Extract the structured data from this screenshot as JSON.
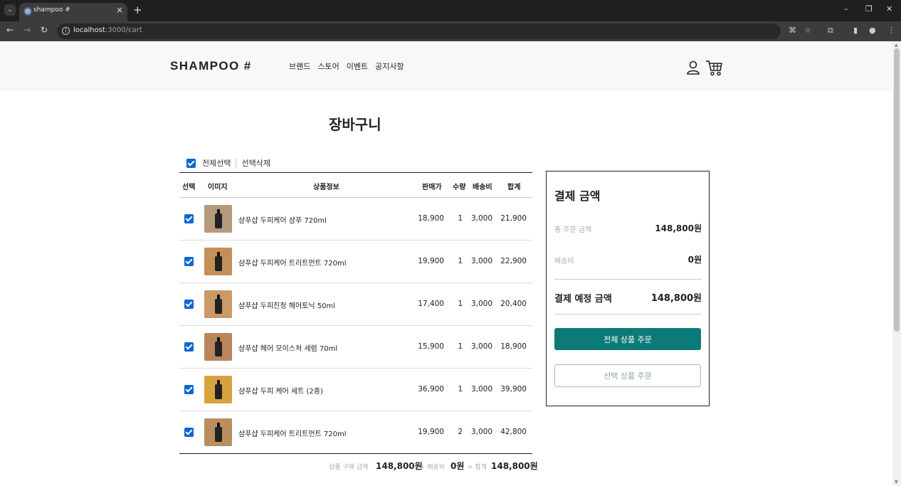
{
  "browser": {
    "tab_title": "shampoo #",
    "url_host": "localhost",
    "url_rest": ":3000/cart"
  },
  "header": {
    "logo": "SHAMPOO #",
    "nav": [
      "브랜드",
      "스토어",
      "이벤트",
      "공지사항"
    ]
  },
  "page_title": "장바구니",
  "select_bar": {
    "select_all": "전체선택",
    "delete_selected": "선택삭제"
  },
  "table": {
    "headers": {
      "select": "선택",
      "image": "이미지",
      "info": "상품정보",
      "price": "판매가",
      "qty": "수량",
      "shipping": "배송비",
      "total": "합계"
    },
    "rows": [
      {
        "name": "샴푸샵 두피케어 샴푸 720ml",
        "price": "18,900",
        "qty": "1",
        "shipping": "3,000",
        "total": "21,900",
        "checked": true,
        "thumb_bg": "#b49a7a"
      },
      {
        "name": "샴푸샵 두피케어 트리트먼트 720ml",
        "price": "19,900",
        "qty": "1",
        "shipping": "3,000",
        "total": "22,900",
        "checked": true,
        "thumb_bg": "#c49058"
      },
      {
        "name": "샴푸샵 두피진정 헤어토닉 50ml",
        "price": "17,400",
        "qty": "1",
        "shipping": "3,000",
        "total": "20,400",
        "checked": true,
        "thumb_bg": "#c99a66"
      },
      {
        "name": "샴푸샵 헤어 모이스처 세럼 70ml",
        "price": "15,900",
        "qty": "1",
        "shipping": "3,000",
        "total": "18,900",
        "checked": true,
        "thumb_bg": "#b8865a"
      },
      {
        "name": "샴푸샵 두피 케어 세트 (2종)",
        "price": "36,900",
        "qty": "1",
        "shipping": "3,000",
        "total": "39,900",
        "checked": true,
        "thumb_bg": "#d9a23c"
      },
      {
        "name": "샴푸샵 두피케어 트리트먼트 720ml",
        "price": "19,900",
        "qty": "2",
        "shipping": "3,000",
        "total": "42,800",
        "checked": true,
        "thumb_bg": "#b98f60"
      }
    ]
  },
  "summary_line": {
    "purchase_label": "상품 구매 금액",
    "purchase_value": "148,800원",
    "shipping_label": "+ 배송비",
    "shipping_value": "0원",
    "total_label": "= 합계",
    "total_value": "148,800원"
  },
  "payment": {
    "title": "결제 금액",
    "order_total_label": "총 주문 금액",
    "order_total_value": "148,800원",
    "shipping_label": "배송비",
    "shipping_value": "0원",
    "expected_label": "결제 예정 금액",
    "expected_value": "148,800원",
    "order_all_button": "전체 상품 주문",
    "order_selected_button": "선택 상품 주문"
  },
  "colors": {
    "accent": "#0c7a78",
    "checkbox": "#0b66d6"
  }
}
